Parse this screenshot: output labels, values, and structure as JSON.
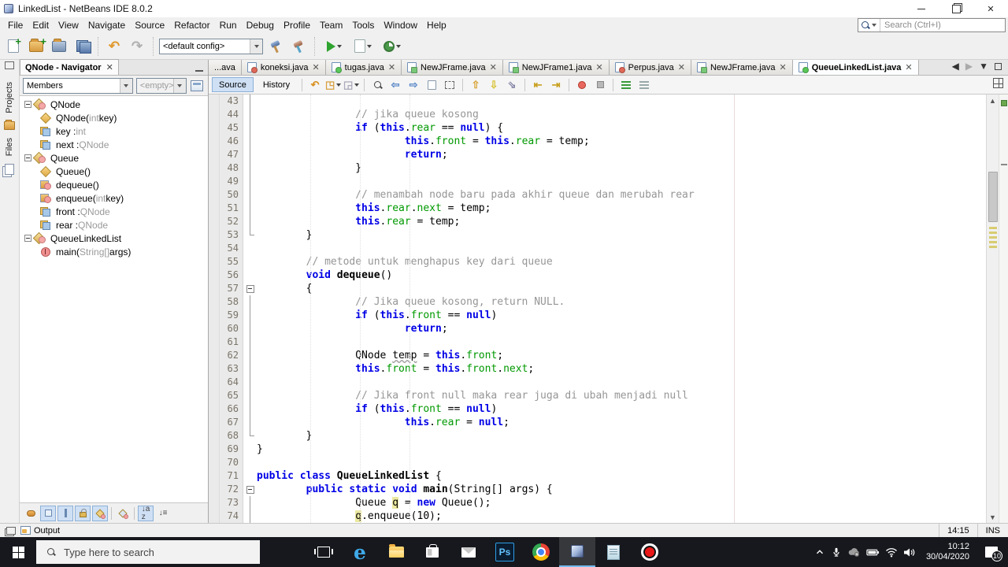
{
  "window": {
    "title": "LinkedList - NetBeans IDE 8.0.2"
  },
  "menubar": {
    "items": [
      "File",
      "Edit",
      "View",
      "Navigate",
      "Source",
      "Refactor",
      "Run",
      "Debug",
      "Profile",
      "Team",
      "Tools",
      "Window",
      "Help"
    ]
  },
  "toolbar": {
    "config_value": "<default config>"
  },
  "ide_search": {
    "placeholder": "Search (Ctrl+I)"
  },
  "dock": {
    "projects_label": "Projects",
    "files_label": "Files"
  },
  "navigator": {
    "tab_title": "QNode - Navigator",
    "members_value": "Members",
    "filter_value": "<empty>",
    "tree": [
      {
        "icon": "class",
        "depth": 0,
        "parts": [
          [
            "QNode",
            "p"
          ]
        ]
      },
      {
        "icon": "ctor",
        "depth": 1,
        "parts": [
          [
            "QNode(",
            "p"
          ],
          [
            "int",
            "m"
          ],
          [
            " key)",
            "p"
          ]
        ]
      },
      {
        "icon": "field",
        "depth": 1,
        "parts": [
          [
            "key : ",
            "p"
          ],
          [
            "int",
            "m"
          ]
        ]
      },
      {
        "icon": "field",
        "depth": 1,
        "parts": [
          [
            "next : ",
            "p"
          ],
          [
            "QNode",
            "m"
          ]
        ]
      },
      {
        "icon": "class",
        "depth": 0,
        "parts": [
          [
            "Queue",
            "p"
          ]
        ]
      },
      {
        "icon": "ctor",
        "depth": 1,
        "parts": [
          [
            "Queue()",
            "p"
          ]
        ]
      },
      {
        "icon": "method",
        "depth": 1,
        "parts": [
          [
            "dequeue()",
            "p"
          ]
        ]
      },
      {
        "icon": "method",
        "depth": 1,
        "parts": [
          [
            "enqueue(",
            "p"
          ],
          [
            "int",
            "m"
          ],
          [
            " key)",
            "p"
          ]
        ]
      },
      {
        "icon": "field",
        "depth": 1,
        "parts": [
          [
            "front : ",
            "p"
          ],
          [
            "QNode",
            "m"
          ]
        ]
      },
      {
        "icon": "field",
        "depth": 1,
        "parts": [
          [
            "rear : ",
            "p"
          ],
          [
            "QNode",
            "m"
          ]
        ]
      },
      {
        "icon": "class",
        "depth": 0,
        "parts": [
          [
            "QueueLinkedList",
            "p"
          ]
        ]
      },
      {
        "icon": "main",
        "depth": 1,
        "parts": [
          [
            "main(",
            "p"
          ],
          [
            "String[]",
            "m"
          ],
          [
            " args)",
            "p"
          ]
        ]
      }
    ]
  },
  "tabs": [
    {
      "label": "...ava",
      "badge": "",
      "partial": true,
      "active": false
    },
    {
      "label": "koneksi.java",
      "badge": "red",
      "active": false
    },
    {
      "label": "tugas.java",
      "badge": "green",
      "active": false
    },
    {
      "label": "NewJFrame.java",
      "badge": "form",
      "active": false
    },
    {
      "label": "NewJFrame1.java",
      "badge": "form",
      "active": false
    },
    {
      "label": "Perpus.java",
      "badge": "red",
      "active": false
    },
    {
      "label": "NewJFrame.java",
      "badge": "form",
      "active": false
    },
    {
      "label": "QueueLinkedList.java",
      "badge": "green",
      "active": true
    }
  ],
  "editor_toolbar": {
    "source_label": "Source",
    "history_label": "History"
  },
  "editor": {
    "lines": [
      {
        "n": 43,
        "fold": "l",
        "seg": []
      },
      {
        "n": 44,
        "fold": "l",
        "seg": [
          [
            "                ",
            "p"
          ],
          [
            "// jika queue kosong",
            "c"
          ]
        ]
      },
      {
        "n": 45,
        "fold": "l",
        "seg": [
          [
            "                ",
            "p"
          ],
          [
            "if",
            "k"
          ],
          [
            " (",
            "p"
          ],
          [
            "this",
            "k"
          ],
          [
            ".",
            "p"
          ],
          [
            "rear",
            "f"
          ],
          [
            " == ",
            "p"
          ],
          [
            "null",
            "k"
          ],
          [
            ") {",
            "p"
          ]
        ]
      },
      {
        "n": 46,
        "fold": "l",
        "seg": [
          [
            "                        ",
            "p"
          ],
          [
            "this",
            "k"
          ],
          [
            ".",
            "p"
          ],
          [
            "front",
            "f"
          ],
          [
            " = ",
            "p"
          ],
          [
            "this",
            "k"
          ],
          [
            ".",
            "p"
          ],
          [
            "rear",
            "f"
          ],
          [
            " = temp;",
            "p"
          ]
        ]
      },
      {
        "n": 47,
        "fold": "l",
        "seg": [
          [
            "                        ",
            "p"
          ],
          [
            "return",
            "k"
          ],
          [
            ";",
            "p"
          ]
        ]
      },
      {
        "n": 48,
        "fold": "l",
        "seg": [
          [
            "                ",
            "p"
          ],
          [
            "}",
            "p"
          ]
        ]
      },
      {
        "n": 49,
        "fold": "l",
        "seg": []
      },
      {
        "n": 50,
        "fold": "l",
        "seg": [
          [
            "                ",
            "p"
          ],
          [
            "// menambah node baru pada akhir queue dan merubah rear",
            "c"
          ]
        ]
      },
      {
        "n": 51,
        "fold": "l",
        "seg": [
          [
            "                ",
            "p"
          ],
          [
            "this",
            "k"
          ],
          [
            ".",
            "p"
          ],
          [
            "rear",
            "f"
          ],
          [
            ".",
            "p"
          ],
          [
            "next",
            "f"
          ],
          [
            " = temp;",
            "p"
          ]
        ]
      },
      {
        "n": 52,
        "fold": "l",
        "seg": [
          [
            "                ",
            "p"
          ],
          [
            "this",
            "k"
          ],
          [
            ".",
            "p"
          ],
          [
            "rear",
            "f"
          ],
          [
            " = temp;",
            "p"
          ]
        ]
      },
      {
        "n": 53,
        "fold": "e",
        "seg": [
          [
            "        ",
            "p"
          ],
          [
            "}",
            "p"
          ]
        ]
      },
      {
        "n": 54,
        "fold": "",
        "seg": []
      },
      {
        "n": 55,
        "fold": "",
        "seg": [
          [
            "        ",
            "p"
          ],
          [
            "// metode untuk menghapus key dari queue",
            "c"
          ]
        ]
      },
      {
        "n": 56,
        "fold": "",
        "seg": [
          [
            "        ",
            "p"
          ],
          [
            "void",
            "k"
          ],
          [
            " ",
            "p"
          ],
          [
            "dequeue",
            "b"
          ],
          [
            "()",
            "p"
          ]
        ]
      },
      {
        "n": 57,
        "fold": "o",
        "seg": [
          [
            "        ",
            "p"
          ],
          [
            "{",
            "p"
          ]
        ]
      },
      {
        "n": 58,
        "fold": "l",
        "seg": [
          [
            "                ",
            "p"
          ],
          [
            "// Jika queue kosong, return NULL.",
            "c"
          ]
        ]
      },
      {
        "n": 59,
        "fold": "l",
        "seg": [
          [
            "                ",
            "p"
          ],
          [
            "if",
            "k"
          ],
          [
            " (",
            "p"
          ],
          [
            "this",
            "k"
          ],
          [
            ".",
            "p"
          ],
          [
            "front",
            "f"
          ],
          [
            " == ",
            "p"
          ],
          [
            "null",
            "k"
          ],
          [
            ")",
            "p"
          ]
        ]
      },
      {
        "n": 60,
        "fold": "l",
        "seg": [
          [
            "                        ",
            "p"
          ],
          [
            "return",
            "k"
          ],
          [
            ";",
            "p"
          ]
        ]
      },
      {
        "n": 61,
        "fold": "l",
        "seg": []
      },
      {
        "n": 62,
        "fold": "l",
        "seg": [
          [
            "                ",
            "p"
          ],
          [
            "QNode ",
            "p"
          ],
          [
            "temp",
            "w"
          ],
          [
            " = ",
            "p"
          ],
          [
            "this",
            "k"
          ],
          [
            ".",
            "p"
          ],
          [
            "front",
            "f"
          ],
          [
            ";",
            "p"
          ]
        ]
      },
      {
        "n": 63,
        "fold": "l",
        "seg": [
          [
            "                ",
            "p"
          ],
          [
            "this",
            "k"
          ],
          [
            ".",
            "p"
          ],
          [
            "front",
            "f"
          ],
          [
            " = ",
            "p"
          ],
          [
            "this",
            "k"
          ],
          [
            ".",
            "p"
          ],
          [
            "front",
            "f"
          ],
          [
            ".",
            "p"
          ],
          [
            "next",
            "f"
          ],
          [
            ";",
            "p"
          ]
        ]
      },
      {
        "n": 64,
        "fold": "l",
        "seg": []
      },
      {
        "n": 65,
        "fold": "l",
        "seg": [
          [
            "                ",
            "p"
          ],
          [
            "// Jika front null maka rear juga di ubah menjadi null",
            "c"
          ]
        ]
      },
      {
        "n": 66,
        "fold": "l",
        "seg": [
          [
            "                ",
            "p"
          ],
          [
            "if",
            "k"
          ],
          [
            " (",
            "p"
          ],
          [
            "this",
            "k"
          ],
          [
            ".",
            "p"
          ],
          [
            "front",
            "f"
          ],
          [
            " == ",
            "p"
          ],
          [
            "null",
            "k"
          ],
          [
            ")",
            "p"
          ]
        ]
      },
      {
        "n": 67,
        "fold": "l",
        "seg": [
          [
            "                        ",
            "p"
          ],
          [
            "this",
            "k"
          ],
          [
            ".",
            "p"
          ],
          [
            "rear",
            "f"
          ],
          [
            " = ",
            "p"
          ],
          [
            "null",
            "k"
          ],
          [
            ";",
            "p"
          ]
        ]
      },
      {
        "n": 68,
        "fold": "e",
        "seg": [
          [
            "        ",
            "p"
          ],
          [
            "}",
            "p"
          ]
        ]
      },
      {
        "n": 69,
        "fold": "",
        "seg": [
          [
            "}",
            "p"
          ]
        ]
      },
      {
        "n": 70,
        "fold": "",
        "seg": []
      },
      {
        "n": 71,
        "fold": "",
        "seg": [
          [
            "public",
            "k"
          ],
          [
            " ",
            "p"
          ],
          [
            "class",
            "k"
          ],
          [
            " ",
            "p"
          ],
          [
            "QueueLinkedList",
            "b"
          ],
          [
            " {",
            "p"
          ]
        ]
      },
      {
        "n": 72,
        "fold": "o",
        "seg": [
          [
            "        ",
            "p"
          ],
          [
            "public",
            "k"
          ],
          [
            " ",
            "p"
          ],
          [
            "static",
            "k"
          ],
          [
            " ",
            "p"
          ],
          [
            "void",
            "k"
          ],
          [
            " ",
            "p"
          ],
          [
            "main",
            "b"
          ],
          [
            "(String[] args) {",
            "p"
          ]
        ]
      },
      {
        "n": 73,
        "fold": "l",
        "seg": [
          [
            "                ",
            "p"
          ],
          [
            "Queue ",
            "p"
          ],
          [
            "q",
            "h"
          ],
          [
            " = ",
            "p"
          ],
          [
            "new",
            "k"
          ],
          [
            " Queue();",
            "p"
          ]
        ]
      },
      {
        "n": 74,
        "fold": "l",
        "seg": [
          [
            "                ",
            "p"
          ],
          [
            "q",
            "h"
          ],
          [
            ".enqueue(10);",
            "p"
          ]
        ]
      }
    ]
  },
  "statusbar": {
    "output_label": "Output",
    "caret_position": "14:15",
    "insert_mode": "INS"
  },
  "taskbar": {
    "search_placeholder": "Type here to search",
    "time": "10:12",
    "date": "30/04/2020",
    "notification_count": "10"
  },
  "colors": {
    "keyword": "#0000e6",
    "field": "#009900",
    "comment": "#969696",
    "occurrence_highlight": "#ece9a1",
    "taskbar_bg": "#16181d",
    "selection_blue": "#cfe0f5"
  }
}
